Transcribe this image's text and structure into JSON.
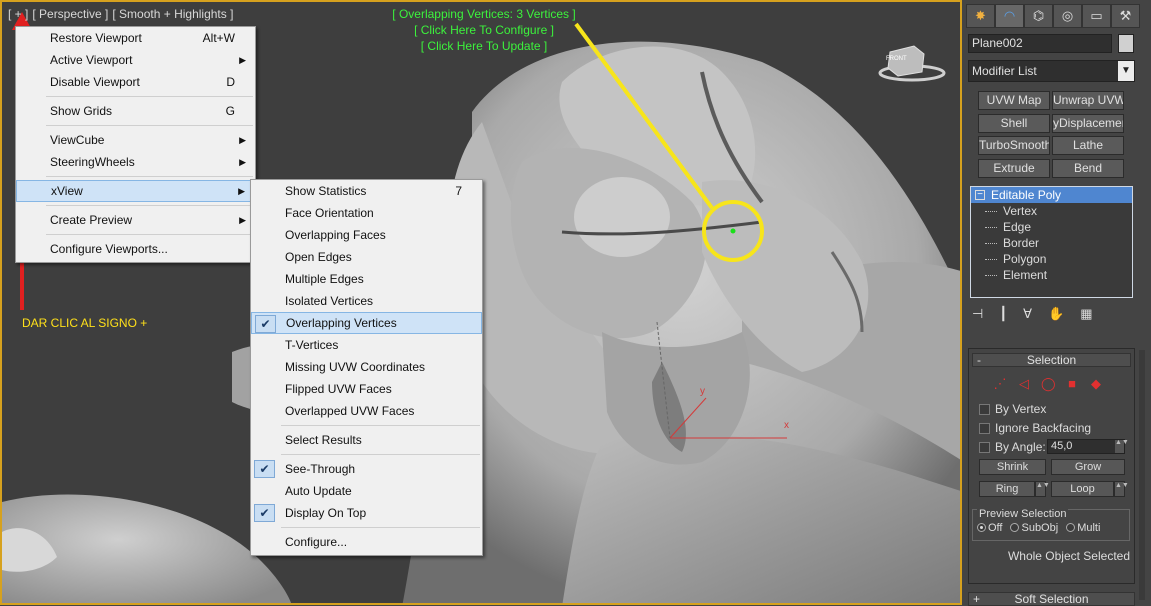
{
  "viewport": {
    "label_plus": "[ + ]",
    "label_view": "[ Perspective ]",
    "label_shading": "[ Smooth + Highlights ]",
    "info_line1": "[ Overlapping Vertices: 3 Vertices ]",
    "info_line2": "[ Click Here To Configure ]",
    "info_line3": "[ Click Here To Update ]",
    "annotation": "DAR CLIC AL SIGNO +",
    "cube_label": "FRONT",
    "axis_y": "y",
    "axis_x": "x",
    "accent_color": "#d6a11e",
    "annotation_color": "#ffe01a",
    "arrow_color": "#e02020",
    "highlight_circle_color": "#f7e51b",
    "info_color": "#3cf23c"
  },
  "context_menu": {
    "items": [
      {
        "label": "Restore Viewport",
        "shortcut": "Alt+W"
      },
      {
        "label": "Active Viewport",
        "arrow": "▶"
      },
      {
        "label": "Disable Viewport",
        "shortcut": "D"
      },
      {
        "label": "Show Grids",
        "shortcut": "G"
      },
      {
        "label": "ViewCube",
        "arrow": "▶"
      },
      {
        "label": "SteeringWheels",
        "arrow": "▶"
      },
      {
        "label": "xView",
        "arrow": "▶"
      },
      {
        "label": "Create Preview",
        "arrow": "▶"
      },
      {
        "label": "Configure Viewports..."
      }
    ]
  },
  "xview_menu": {
    "items": [
      {
        "label": "Show Statistics",
        "shortcut": "7"
      },
      {
        "label": "Face Orientation"
      },
      {
        "label": "Overlapping Faces"
      },
      {
        "label": "Open Edges"
      },
      {
        "label": "Multiple Edges"
      },
      {
        "label": "Isolated Vertices"
      },
      {
        "label": "Overlapping Vertices",
        "check": "✔"
      },
      {
        "label": "T-Vertices"
      },
      {
        "label": "Missing UVW Coordinates"
      },
      {
        "label": "Flipped UVW Faces"
      },
      {
        "label": "Overlapped UVW Faces"
      },
      {
        "label": "Select Results"
      },
      {
        "label": "See-Through",
        "check": "✔"
      },
      {
        "label": "Auto Update"
      },
      {
        "label": "Display On Top",
        "check": "✔"
      },
      {
        "label": "Configure..."
      }
    ]
  },
  "command_panel": {
    "tabs": [
      "✸",
      "◠",
      "⌬",
      "◎",
      "▭",
      "⚒"
    ],
    "object_name": "Plane002",
    "modifier_list": "Modifier List",
    "dropdown_arrow": "▼",
    "modifier_buttons": [
      "UVW Map",
      "Unwrap UVW",
      "Shell",
      "yDisplacement",
      "TurboSmooth",
      "Lathe",
      "Extrude",
      "Bend"
    ],
    "stack_root": "Editable Poly",
    "stack_root_toggle": "−",
    "stack_subs": [
      "Vertex",
      "Edge",
      "Border",
      "Polygon",
      "Element"
    ],
    "stack_icons": [
      "⊣",
      "┃",
      "∀",
      "✋",
      "▦"
    ],
    "selection_title": "Selection",
    "selection_toggle": "-",
    "selection_icons": [
      "⋰",
      "◁",
      "◯",
      "■",
      "◆"
    ],
    "by_vertex": "By Vertex",
    "ignore_backfacing": "Ignore Backfacing",
    "by_angle": "By Angle:",
    "angle_value": "45,0",
    "spin_arrows": "▲▼",
    "shrink": "Shrink",
    "grow": "Grow",
    "ring": "Ring",
    "loop": "Loop",
    "preview_selection": "Preview Selection",
    "radio_off": "Off",
    "radio_subobj": "SubObj",
    "radio_multi": "Multi",
    "status": "Whole Object Selected",
    "soft_selection": "Soft Selection",
    "soft_toggle": "+"
  }
}
